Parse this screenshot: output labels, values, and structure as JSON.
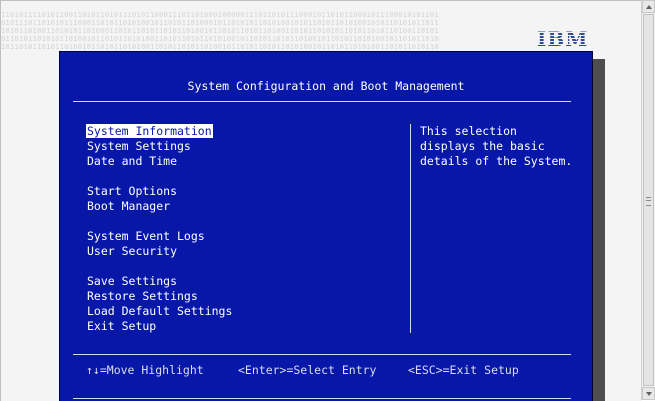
{
  "logo": "IBM",
  "binary_rows": [
    "1101011110101100110101101011101011000111011010001000001110110101110001011010110001011100010101101",
    "0101110110101011100011010110101001011010110100010110101011010100101011010110101001010110101011011",
    "1010110100110101011010001101011010110101101001011010110101101001101011010101101011010110100110101",
    "0110101101010110100101101011010100110101101011010100101101011010110100101101011010100101101011010",
    "1011010110101101001011010110101001101011010110100101101011010110101001011010110101001101011010110"
  ],
  "screen": {
    "title": "System Configuration and Boot Management",
    "menu": [
      {
        "label": "System Information",
        "selected": true
      },
      {
        "label": "System Settings",
        "selected": false
      },
      {
        "label": "Date and Time",
        "selected": false
      },
      {
        "label": "Start Options",
        "selected": false
      },
      {
        "label": "Boot Manager",
        "selected": false
      },
      {
        "label": "System Event Logs",
        "selected": false
      },
      {
        "label": "User Security",
        "selected": false
      },
      {
        "label": "Save Settings",
        "selected": false
      },
      {
        "label": "Restore Settings",
        "selected": false
      },
      {
        "label": "Load Default Settings",
        "selected": false
      },
      {
        "label": "Exit Setup",
        "selected": false
      }
    ],
    "help_lines": [
      "This selection",
      "displays the basic",
      "details of the System."
    ],
    "footer": {
      "move": "↑↓=Move Highlight",
      "enter": "<Enter>=Select Entry",
      "esc": "<ESC>=Exit Setup"
    }
  },
  "colors": {
    "panel": "#0718a8",
    "text": "#ffffff",
    "highlight_bg": "#ffffff",
    "logo": "#2a4b8d"
  }
}
